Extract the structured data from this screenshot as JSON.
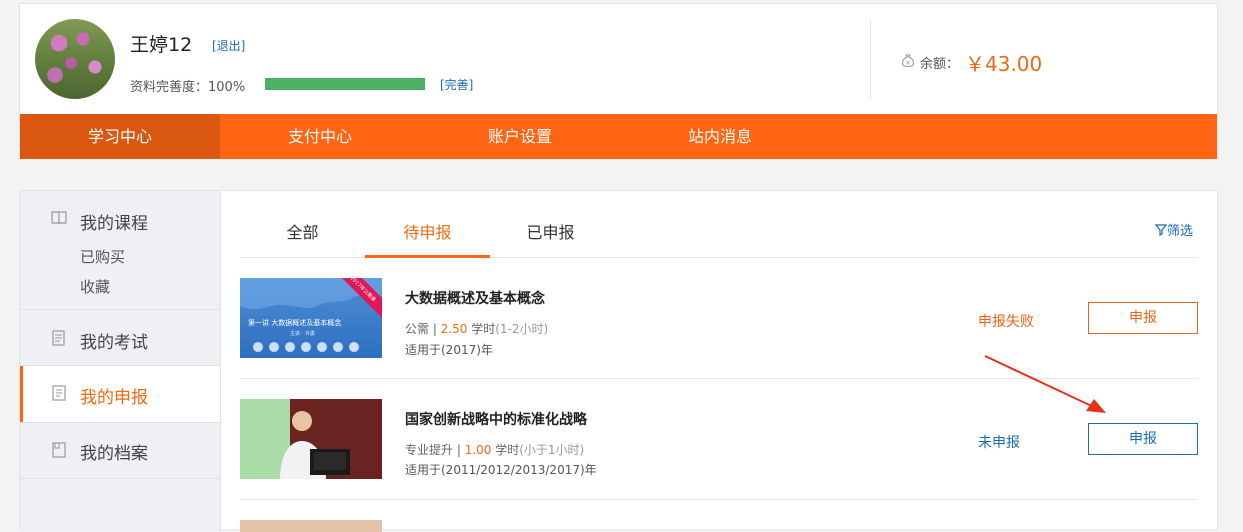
{
  "user": {
    "name": "王婷12",
    "logout_label": "[退出]",
    "completeness_label": "资料完善度：100%",
    "completeness_value": 1.0,
    "complete_link": "[完善]",
    "balance_label": "余额：",
    "balance_amount": "￥43.00"
  },
  "nav": {
    "items": [
      "学习中心",
      "支付中心",
      "账户设置",
      "站内消息"
    ],
    "active_index": 0
  },
  "sidebar": {
    "courses_title": "我的课程",
    "courses_sub": [
      "已购买",
      "收藏"
    ],
    "exams_title": "我的考试",
    "reports_title": "我的申报",
    "archive_title": "我的档案",
    "active": "我的申报"
  },
  "tabs": {
    "items": [
      "全部",
      "待申报",
      "已申报"
    ],
    "active_index": 1,
    "filter_label": "筛选"
  },
  "courses": [
    {
      "title": "大数据概述及基本概念",
      "category": "公需",
      "sep": " | ",
      "hours": "2.50",
      "hours_unit": " 学时",
      "duration": "(1-2小时)",
      "year": "适用于(2017)年",
      "status": "申报失败",
      "button": "申报",
      "thumb_text": "第一讲  大数据概述及基本概念",
      "thumb_sub": "主讲：许勇",
      "thumb_ribbon": "2017年公需课"
    },
    {
      "title": "国家创新战略中的标准化战略",
      "category": "专业提升",
      "sep": " | ",
      "hours": "1.00",
      "hours_unit": " 学时",
      "duration": "(小于1小时)",
      "year": "适用于(2011/2012/2013/2017)年",
      "status": "未申报",
      "button": "申报"
    }
  ],
  "colors": {
    "accent": "#ff6512",
    "link": "#1a6cb5",
    "progress": "#4caf61"
  }
}
